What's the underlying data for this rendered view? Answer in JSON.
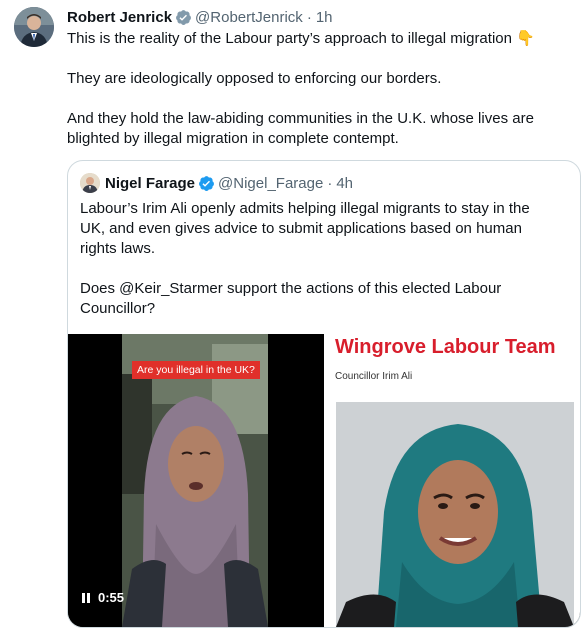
{
  "tweet": {
    "author_name": "Robert Jenrick",
    "handle": "@RobertJenrick",
    "time": "1h",
    "paragraphs": [
      "This is the reality of the Labour party’s approach to illegal migration 👇",
      "They are ideologically opposed to enforcing our borders.",
      "And they hold the law-abiding communities in the U.K. whose lives are blighted by illegal migration in complete contempt."
    ]
  },
  "quote": {
    "author_name": "Nigel Farage",
    "handle": "@Nigel_Farage",
    "time": "4h",
    "paragraphs": [
      "Labour’s Irim Ali openly admits helping illegal migrants to stay in the UK, and even gives advice to submit applications based on human rights laws.",
      "Does @Keir_Starmer support the actions of this elected Labour Councillor?"
    ],
    "video": {
      "caption": "Are you illegal in the UK?",
      "duration": "0:55"
    },
    "image": {
      "title": "Wingrove Labour Team",
      "subtitle": "Councillor Irim Ali"
    }
  },
  "colors": {
    "verified": "#1d9bf0",
    "muted": "#536471",
    "labour_red": "#d81e2c",
    "badge_red": "#e0302a"
  },
  "icons": {
    "verified": "verified-badge-icon",
    "pause": "pause-icon"
  }
}
